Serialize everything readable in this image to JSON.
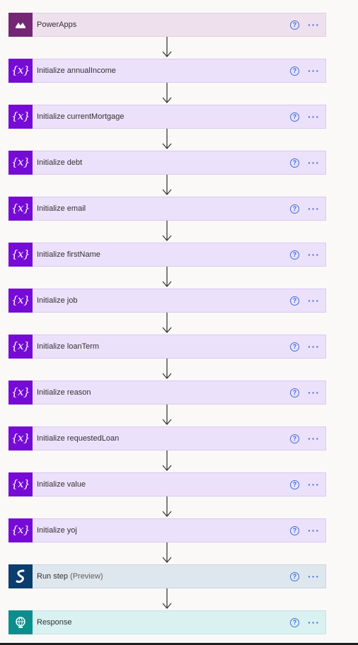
{
  "steps": [
    {
      "type": "powerapps",
      "title": "PowerApps",
      "suffix": "",
      "icon": "powerapps-icon"
    },
    {
      "type": "variable",
      "title": "Initialize annualIncome",
      "suffix": "",
      "icon": "variable-icon"
    },
    {
      "type": "variable",
      "title": "Initialize currentMortgage",
      "suffix": "",
      "icon": "variable-icon"
    },
    {
      "type": "variable",
      "title": "Initialize debt",
      "suffix": "",
      "icon": "variable-icon"
    },
    {
      "type": "variable",
      "title": "Initialize email",
      "suffix": "",
      "icon": "variable-icon"
    },
    {
      "type": "variable",
      "title": "Initialize firstName",
      "suffix": "",
      "icon": "variable-icon"
    },
    {
      "type": "variable",
      "title": "Initialize job",
      "suffix": "",
      "icon": "variable-icon"
    },
    {
      "type": "variable",
      "title": "Initialize loanTerm",
      "suffix": "",
      "icon": "variable-icon"
    },
    {
      "type": "variable",
      "title": "Initialize reason",
      "suffix": "",
      "icon": "variable-icon"
    },
    {
      "type": "variable",
      "title": "Initialize requestedLoan",
      "suffix": "",
      "icon": "variable-icon"
    },
    {
      "type": "variable",
      "title": "Initialize value",
      "suffix": "",
      "icon": "variable-icon"
    },
    {
      "type": "variable",
      "title": "Initialize yoj",
      "suffix": "",
      "icon": "variable-icon"
    },
    {
      "type": "runstep",
      "title": "Run step",
      "suffix": "(Preview)",
      "icon": "run-step-icon"
    },
    {
      "type": "response",
      "title": "Response",
      "suffix": "",
      "icon": "response-icon"
    }
  ],
  "variable_glyph": "{x}",
  "help_glyph": "?",
  "more_glyph": "···",
  "colors": {
    "variable_accent": "#770bd6",
    "powerapps_accent": "#742774",
    "runstep_accent": "#0b3d6e",
    "response_accent": "#0e8d8d",
    "link_blue": "#3a6fd8"
  }
}
